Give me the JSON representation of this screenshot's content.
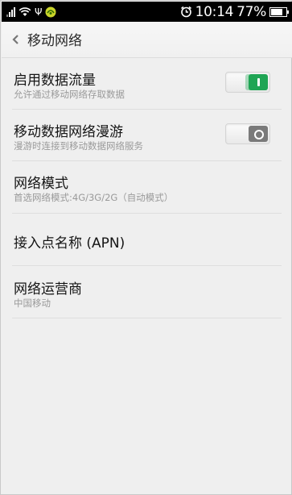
{
  "status_bar": {
    "time": "10:14",
    "battery_text": "77%",
    "battery_level": 0.77,
    "icons": [
      "signal-icon",
      "wifi-icon",
      "usb-icon",
      "notification-icon",
      "alarm-icon",
      "battery-icon"
    ]
  },
  "header": {
    "back_icon": "chevron-left-icon",
    "title": "移动网络"
  },
  "settings": [
    {
      "title": "启用数据流量",
      "subtitle": "允许通过移动网络存取数据",
      "toggle": "on"
    },
    {
      "title": "移动数据网络漫游",
      "subtitle": "漫游时连接到移动数据网络服务",
      "toggle": "off"
    },
    {
      "title": "网络模式",
      "subtitle": "首选网络模式:4G/3G/2G（自动模式）"
    },
    {
      "title": "接入点名称 (APN)"
    },
    {
      "title": "网络运营商",
      "subtitle": "中国移动"
    }
  ],
  "colors": {
    "accent": "#1fa554",
    "toggle_off": "#7a7a7a",
    "background": "#efefef"
  }
}
